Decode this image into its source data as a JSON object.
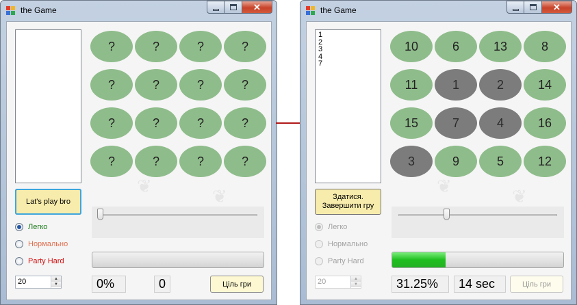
{
  "colors": {
    "tile_green": "#8fbc8b",
    "tile_revealed": "#7c7c7c",
    "button_yellow": "#f8ecac",
    "progress_green": "#22c322",
    "arrow_red": "#b01818"
  },
  "before": {
    "window": {
      "title": "the Game",
      "icon": "app-icon"
    },
    "moves_list": [],
    "tiles": [
      "?",
      "?",
      "?",
      "?",
      "?",
      "?",
      "?",
      "?",
      "?",
      "?",
      "?",
      "?",
      "?",
      "?",
      "?",
      "?"
    ],
    "revealed": [
      false,
      false,
      false,
      false,
      false,
      false,
      false,
      false,
      false,
      false,
      false,
      false,
      false,
      false,
      false,
      false
    ],
    "main_button": {
      "line1": "Lat's play bro",
      "line2": ""
    },
    "difficulty": [
      {
        "label": "Легко",
        "color": "#1a7a1a",
        "selected": true
      },
      {
        "label": "Нормально",
        "color": "#e07050",
        "selected": false
      },
      {
        "label": "Party Hard",
        "color": "#d01010",
        "selected": false
      }
    ],
    "slider_level": 0.0,
    "progress_fraction": 0.0,
    "spinner_value": "20",
    "percent_text": "0%",
    "time_text": "0",
    "goal_button": "Ціль гри"
  },
  "after": {
    "window": {
      "title": "the Game",
      "icon": "app-icon"
    },
    "moves_list": [
      "1",
      "2",
      "3",
      "4",
      "7"
    ],
    "tiles": [
      "10",
      "6",
      "13",
      "8",
      "11",
      "1",
      "2",
      "14",
      "15",
      "7",
      "4",
      "16",
      "3",
      "9",
      "5",
      "12"
    ],
    "revealed": [
      false,
      false,
      false,
      false,
      false,
      true,
      true,
      false,
      false,
      true,
      true,
      false,
      true,
      false,
      false,
      false
    ],
    "main_button": {
      "line1": "Здатися.",
      "line2": "Завершити гру"
    },
    "difficulty": [
      {
        "label": "Легко",
        "selected": true
      },
      {
        "label": "Нормально",
        "selected": false
      },
      {
        "label": "Party Hard",
        "selected": false
      }
    ],
    "slider_level": 0.3,
    "progress_fraction": 0.3125,
    "spinner_value": "20",
    "percent_text": "31.25%",
    "time_text": "14 sec",
    "goal_button": "Ціль гри"
  }
}
